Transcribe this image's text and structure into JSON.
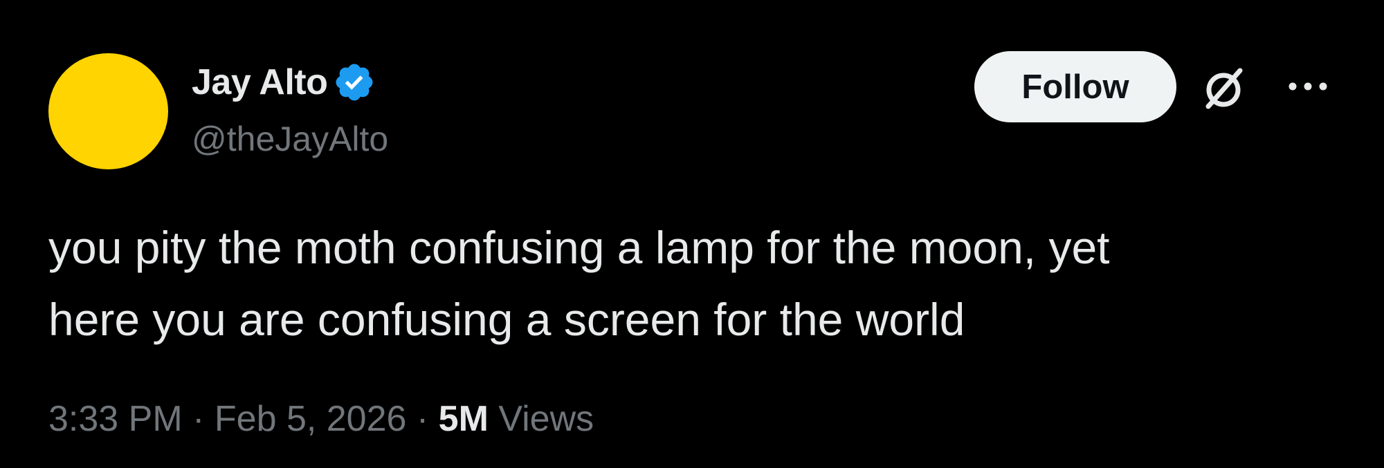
{
  "author": {
    "display_name": "Jay Alto",
    "handle": "@theJayAlto",
    "verified": true,
    "avatar_color": "#ffd400",
    "badge_color": "#1d9bf0"
  },
  "actions": {
    "follow_label": "Follow",
    "grok_icon": "grok-icon",
    "more_icon": "more-icon"
  },
  "tweet": {
    "text": "you pity the moth confusing a lamp for the moon, yet\nhere you are confusing a screen for the world"
  },
  "meta": {
    "time": "3:33 PM",
    "separator": "·",
    "date": "Feb 5, 2026",
    "views_count": "5M",
    "views_label": "Views"
  }
}
